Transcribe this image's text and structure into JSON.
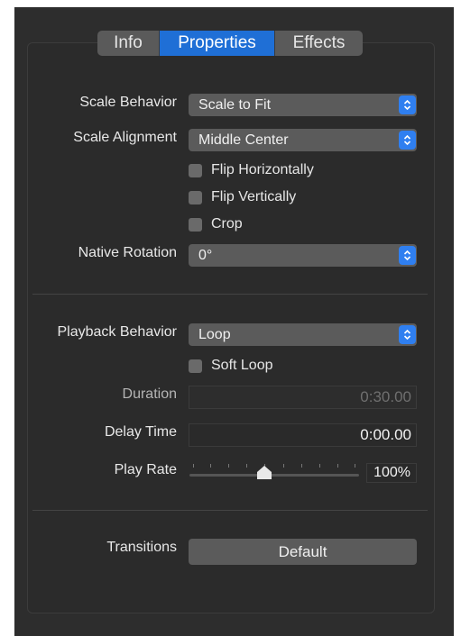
{
  "tabs": [
    {
      "label": "Info",
      "active": false
    },
    {
      "label": "Properties",
      "active": true
    },
    {
      "label": "Effects",
      "active": false
    }
  ],
  "scale": {
    "behavior_label": "Scale Behavior",
    "behavior_value": "Scale to Fit",
    "alignment_label": "Scale Alignment",
    "alignment_value": "Middle Center",
    "flip_h_label": "Flip Horizontally",
    "flip_h_checked": false,
    "flip_v_label": "Flip Vertically",
    "flip_v_checked": false,
    "crop_label": "Crop",
    "crop_checked": false,
    "rotation_label": "Native Rotation",
    "rotation_value": "0°"
  },
  "playback": {
    "behavior_label": "Playback Behavior",
    "behavior_value": "Loop",
    "soft_loop_label": "Soft Loop",
    "soft_loop_checked": false,
    "duration_label": "Duration",
    "duration_value": "0:30.00",
    "delay_label": "Delay Time",
    "delay_value": "0:00.00",
    "rate_label": "Play Rate",
    "rate_value": "100%",
    "rate_slider_fraction": 0.45
  },
  "transitions": {
    "label": "Transitions",
    "button_label": "Default"
  },
  "colors": {
    "accent": "#1f6fd6",
    "popup_arrow": "#2f7ff0",
    "panel_bg": "#2b2b2b",
    "control_bg": "#5b5b5b"
  }
}
